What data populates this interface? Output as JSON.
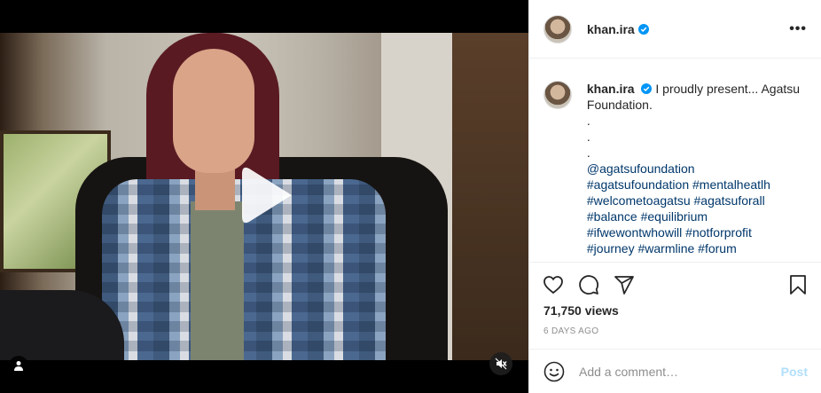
{
  "media": {
    "play_icon": "play-icon",
    "user_tag_icon": "user-icon",
    "mute_icon": "muted-speaker-icon"
  },
  "header": {
    "username": "khan.ira",
    "verified_icon": "verified-badge-icon",
    "more_icon": "•••"
  },
  "caption": {
    "username": "khan.ira",
    "text": "I proudly present... Agatsu Foundation.",
    "dots": [
      ".",
      ".",
      "."
    ],
    "mention": "@agatsufoundation",
    "hashtag_lines": [
      "#agatsufoundation #mentalheatlh",
      "#welcometoagatsu #agatsuforall",
      "#balance #equilibrium",
      "#ifwewontwhowill #notforprofit",
      "#journey #warmline #forum"
    ]
  },
  "actions": {
    "like_icon": "heart-icon",
    "comment_icon": "comment-icon",
    "share_icon": "share-icon",
    "save_icon": "bookmark-icon"
  },
  "stats": {
    "views": "71,750 views",
    "posted": "6 DAYS AGO"
  },
  "comment": {
    "placeholder": "Add a comment…",
    "post_label": "Post",
    "emoji_icon": "emoji-icon"
  },
  "colors": {
    "link": "#00376b",
    "verified": "#0095f6",
    "post_disabled": "#b2dffc",
    "muted_text": "#8e8e8e"
  }
}
